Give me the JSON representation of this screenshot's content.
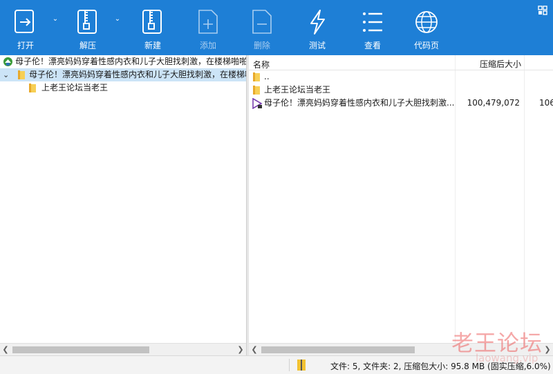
{
  "toolbar": {
    "open": "打开",
    "extract": "解压",
    "new": "新建",
    "add": "添加",
    "delete": "删除",
    "test": "测试",
    "view": "查看",
    "codepage": "代码页"
  },
  "tree": {
    "root": "母子伦！漂亮妈妈穿着性感内衣和儿子大胆找刺激，在楼梯啪啪",
    "folder": "母子伦！漂亮妈妈穿着性感内衣和儿子大胆找刺激，在楼梯啪",
    "child": "上老王论坛当老王"
  },
  "list": {
    "col_name": "名称",
    "col_packed": "压缩后大小",
    "rows": [
      {
        "name": "..",
        "packed": "",
        "size": ""
      },
      {
        "name": "上老王论坛当老王",
        "packed": "",
        "size": ""
      },
      {
        "name": "母子伦！漂亮妈妈穿着性感内衣和儿子大胆找刺激...",
        "packed": "100,479,072",
        "size": "106"
      }
    ]
  },
  "status": {
    "text": "文件: 5, 文件夹: 2, 压缩包大小: 95.8 MB (固实压缩,6.0%)"
  },
  "watermark": {
    "text": "老王论坛",
    "sub": "laowang.vip"
  },
  "colors": {
    "toolbar_bg": "#1e7fd6",
    "selection": "#cce4f7",
    "folder": "#f7cf55"
  }
}
